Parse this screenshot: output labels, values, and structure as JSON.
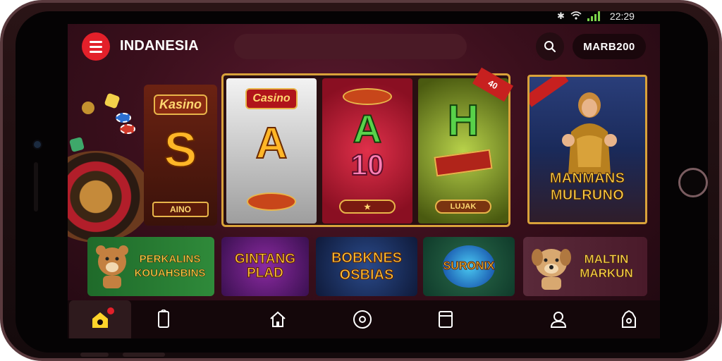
{
  "status_bar": {
    "time": "22:29",
    "icons": [
      "bluetooth-icon",
      "wifi-icon",
      "signal-icon"
    ]
  },
  "header": {
    "title": "INDANESIA",
    "search_placeholder": "",
    "balance": "MARB200"
  },
  "featured": {
    "left_card": {
      "brand": "Kasino",
      "letter": "S",
      "button": "AINO"
    },
    "reels": [
      {
        "brand": "Casino",
        "letter": "A",
        "button": ""
      },
      {
        "brand": "",
        "letter": "A",
        "subletter": "10",
        "button": ""
      },
      {
        "brand": "",
        "letter": "H",
        "button": "LUJAK",
        "corner": "40"
      }
    ],
    "hero": {
      "title": "MANMANS MULRUNO"
    }
  },
  "games": [
    {
      "title": "PERKALINS KOUAHSBINS"
    },
    {
      "title": "GINTANG PLAD"
    },
    {
      "title": "BOBKNES OSBIAS"
    },
    {
      "title": "SURONIX"
    },
    {
      "title": "MALTIN MARKUN"
    }
  ],
  "nav": {
    "items": [
      {
        "icon": "home-active-icon",
        "active": true
      },
      {
        "icon": "phone-icon"
      },
      {
        "icon": "house-icon"
      },
      {
        "icon": "record-icon"
      },
      {
        "icon": "cards-icon"
      },
      {
        "icon": "user-icon"
      },
      {
        "icon": "bag-icon"
      }
    ]
  },
  "colors": {
    "accent": "#e3202a",
    "gold": "#d9a23a",
    "bg": "#3a0f1c"
  }
}
